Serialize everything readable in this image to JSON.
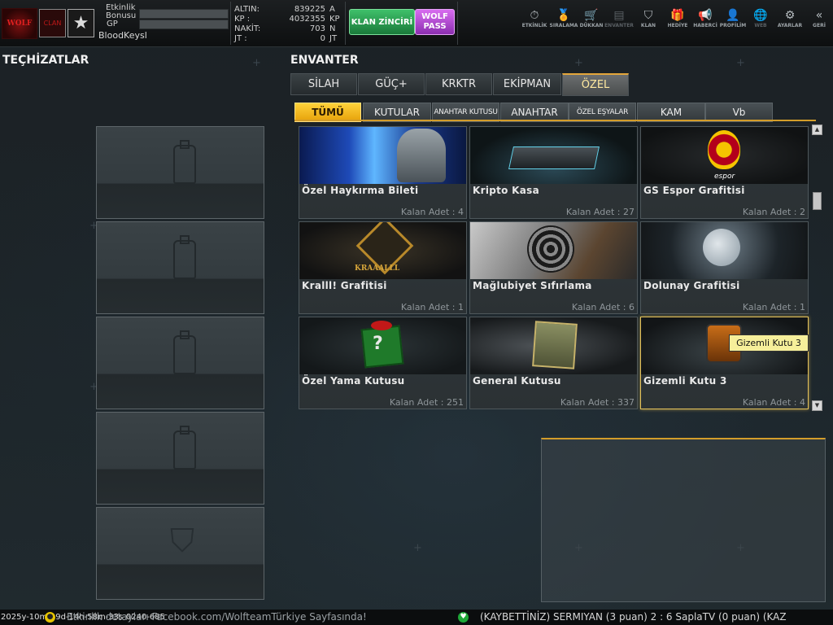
{
  "topbar": {
    "logo_text": "WOLF",
    "emblem_text": "CLAN",
    "rank_icon": "star-icon",
    "etkinlik_label": "Etkinlik Bonusu",
    "gp_label": "GP",
    "username": "BloodKeysl",
    "currencies": [
      {
        "label": "ALTIN:",
        "value": "839225",
        "unit": "A"
      },
      {
        "label": "KP :",
        "value": "4032355",
        "unit": "KP"
      },
      {
        "label": "NAKİT:",
        "value": "703",
        "unit": "N"
      },
      {
        "label": "JT :",
        "value": "0",
        "unit": "JT"
      }
    ],
    "clan_chain_label": "KLAN ZİNCİRİ",
    "wolf_pass_label": "WOLF PASS",
    "nav": [
      {
        "label": "ETKİNLİK",
        "icon": "stopwatch-icon",
        "glyph": "⏱",
        "enabled": true
      },
      {
        "label": "SIRALAMA",
        "icon": "medal-icon",
        "glyph": "🏅",
        "enabled": true
      },
      {
        "label": "DÜKKAN",
        "icon": "cart-icon",
        "glyph": "🛒",
        "enabled": true
      },
      {
        "label": "ENVANTER",
        "icon": "inventory-icon",
        "glyph": "▤",
        "enabled": false
      },
      {
        "label": "KLAN",
        "icon": "shield-icon",
        "glyph": "⛉",
        "enabled": true
      },
      {
        "label": "HEDİYE",
        "icon": "gift-icon",
        "glyph": "🎁",
        "enabled": true
      },
      {
        "label": "HABERCİ",
        "icon": "megaphone-icon",
        "glyph": "📢",
        "enabled": true
      },
      {
        "label": "PROFİLİM",
        "icon": "profile-icon",
        "glyph": "👤",
        "enabled": true
      },
      {
        "label": "WEB",
        "icon": "globe-icon",
        "glyph": "🌐",
        "enabled": false
      },
      {
        "label": "AYARLAR",
        "icon": "gear-icon",
        "glyph": "⚙",
        "enabled": true
      },
      {
        "label": "GERİ",
        "icon": "back-arrows-icon",
        "glyph": "«",
        "enabled": true
      }
    ]
  },
  "equipment": {
    "title": "TEÇHİZATLAR",
    "slots": [
      "spray-slot-icon",
      "spray-slot-icon",
      "spray-slot-icon",
      "spray-slot-icon",
      "shield-slot-icon"
    ]
  },
  "inventory": {
    "title": "ENVANTER",
    "main_tabs": [
      "SİLAH",
      "GÜÇ+",
      "KRKTR",
      "EKİPMAN",
      "ÖZEL"
    ],
    "active_main_tab": "ÖZEL",
    "sub_tabs": [
      "TÜMÜ",
      "KUTULAR",
      "ANAHTAR KUTUSU",
      "ANAHTAR",
      "ÖZEL EŞYALAR",
      "KAM",
      "Vb"
    ],
    "active_sub_tab": "TÜMÜ",
    "count_prefix": "Kalan Adet :",
    "items": [
      {
        "name": "Özel Haykırma Bileti",
        "count": "4",
        "art": "soldier-blue-energy-art",
        "selected": false
      },
      {
        "name": "Kripto Kasa",
        "count": "27",
        "art": "crypto-case-art",
        "selected": false
      },
      {
        "name": "GS Espor Grafitisi",
        "count": "2",
        "art": "galatasaray-logo-art",
        "logo_text": "espor",
        "selected": false
      },
      {
        "name": "Kralll! Grafitisi",
        "count": "1",
        "art": "kraaalll-lion-art",
        "logo_text": "KRAAALLL",
        "selected": false
      },
      {
        "name": "Mağlubiyet  Sıfırlama",
        "count": "6",
        "art": "target-gun-art",
        "selected": false
      },
      {
        "name": "Dolunay Grafitisi",
        "count": "1",
        "art": "full-moon-wolf-art",
        "selected": false
      },
      {
        "name": "Özel Yama Kutusu",
        "count": "251",
        "art": "green-gift-box-art",
        "selected": false
      },
      {
        "name": "General Kutusu",
        "count": "337",
        "art": "general-crate-art",
        "selected": false
      },
      {
        "name": "Gizemli Kutu 3",
        "count": "4",
        "art": "mystery-box-art",
        "selected": true
      }
    ],
    "tooltip": "Gizemli Kutu 3"
  },
  "ticker": {
    "timestamp": "2025y-10m-19d-14h-58m-33s-0240-685",
    "message1": "Etkinlik detayları Facebook.com/WolfteamTürkiye Sayfasında!",
    "message2": "(KAYBETTİNİZ) SERMIYAN (3 puan) 2 : 6 SaplaTV (0 puan) (KAZ"
  },
  "colors": {
    "accent_gold": "#d39d2a",
    "active_subtab": "#ffd23a",
    "clan_green": "#2fa052",
    "wolf_purple": "#b44fd6"
  }
}
